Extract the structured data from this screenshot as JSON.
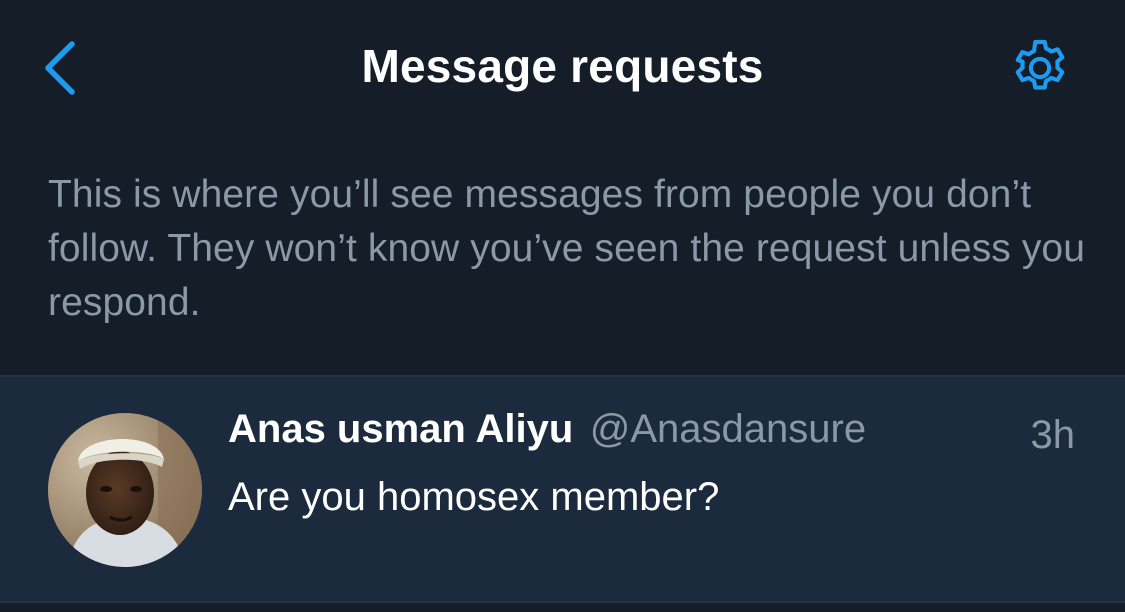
{
  "header": {
    "title": "Message requests",
    "back_icon": "chevron-left-icon",
    "settings_icon": "gear-icon"
  },
  "info": {
    "text": "This is where you’ll see messages from people you don’t follow. They won’t know you’ve seen the request unless you respond."
  },
  "requests": [
    {
      "name": "Anas usman Aliyu",
      "handle": "@Anasdansure",
      "time": "3h",
      "message": "Are you homosex member?"
    }
  ],
  "colors": {
    "background": "#151d28",
    "accent": "#1d9bf0",
    "row_background": "#1b2a3c",
    "secondary_text": "#8b98a5",
    "primary_text": "#ffffff"
  }
}
